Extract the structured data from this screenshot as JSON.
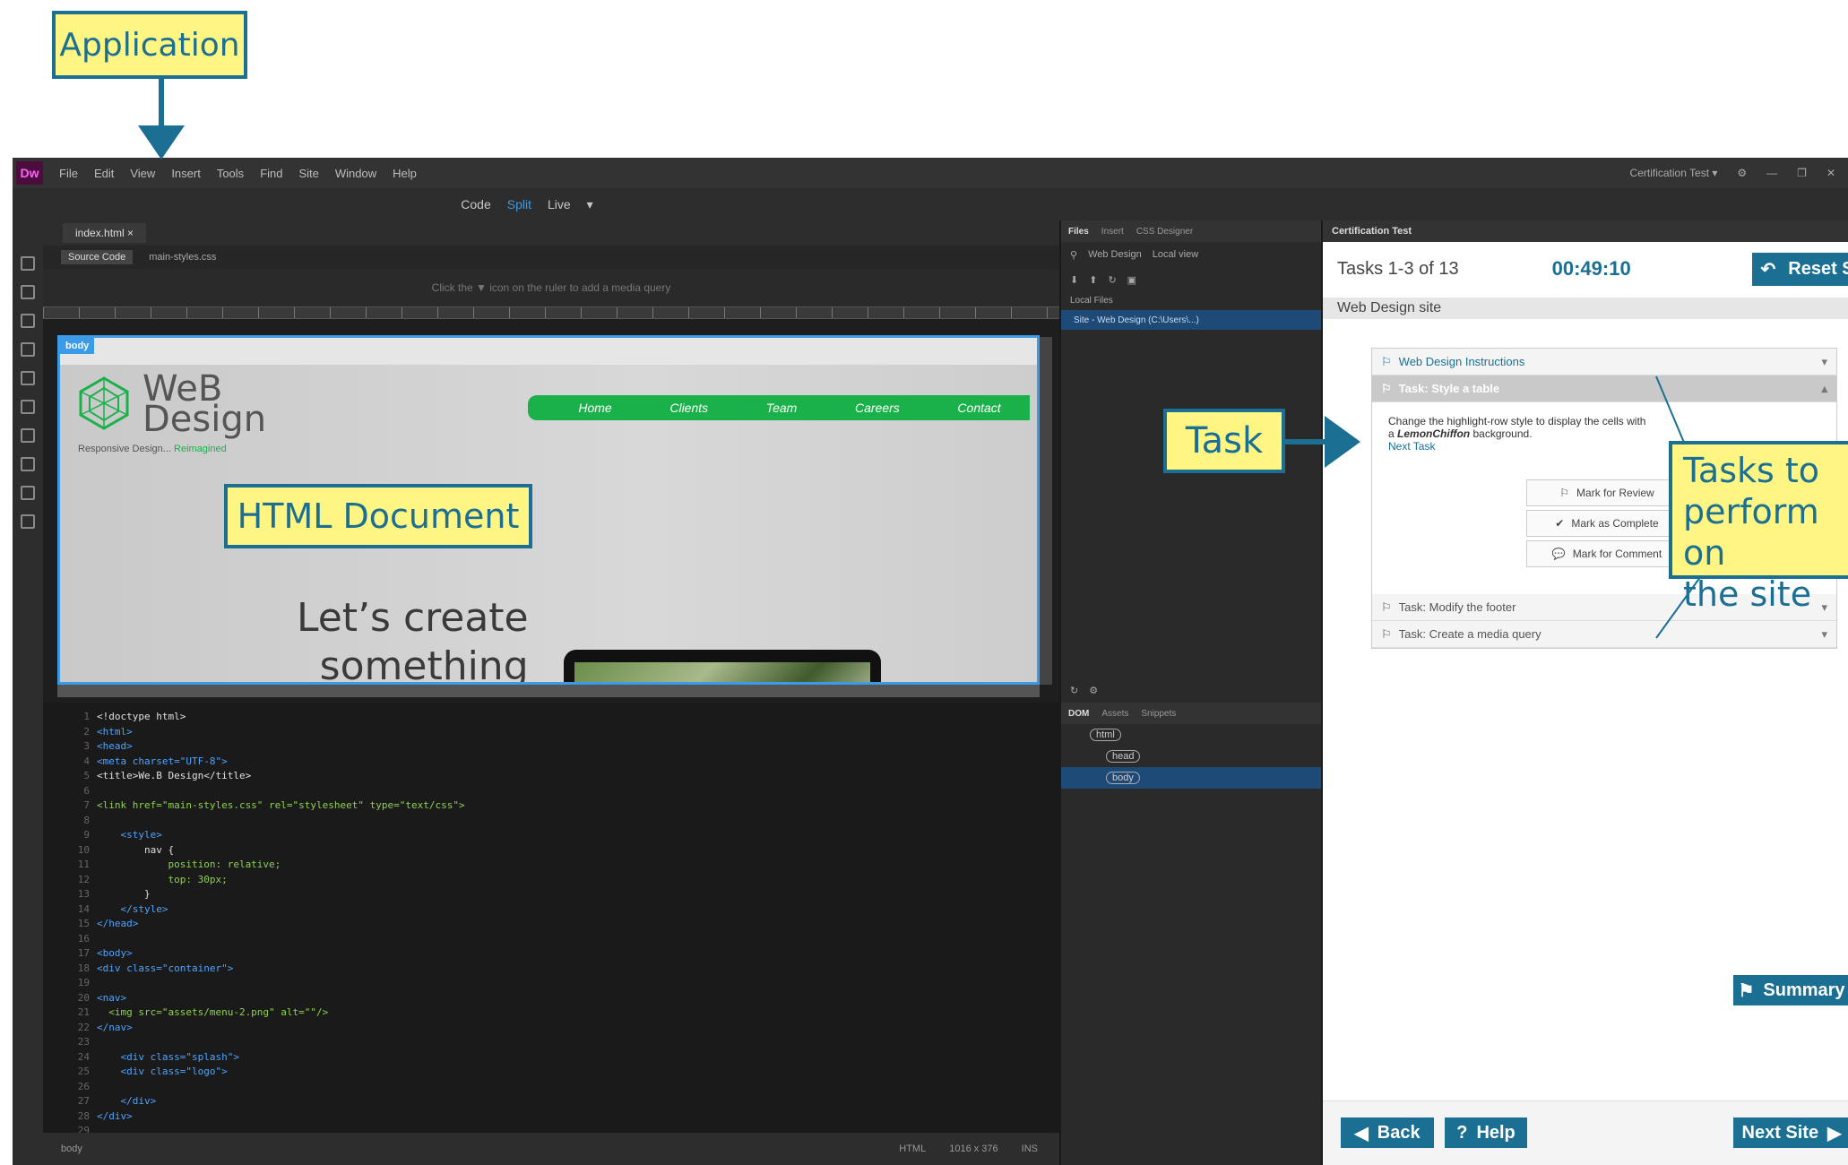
{
  "callouts": {
    "application": "Application",
    "html_document": "HTML Document",
    "task": "Task",
    "tasks_line1": "Tasks to",
    "tasks_line2": "perform on",
    "tasks_line3": "the site"
  },
  "menubar": {
    "logo": "Dw",
    "items": [
      "File",
      "Edit",
      "View",
      "Insert",
      "Tools",
      "Find",
      "Site",
      "Window",
      "Help"
    ],
    "workspace": "Certification Test",
    "workspace_chevron": "▾"
  },
  "viewbar": {
    "code": "Code",
    "split": "Split",
    "live": "Live",
    "chevron": "▾"
  },
  "document": {
    "tab": "index.html",
    "tab_close": "×",
    "related_files": [
      "Source Code",
      "main-styles.css"
    ],
    "media_query_hint": "Click the ▼ icon on the ruler to add a media query",
    "body_tag": "body",
    "site": {
      "logo_line1": "WeB",
      "logo_line2": "Design",
      "tagline": "Responsive Design...",
      "tagline_accent": "Reimagined",
      "nav": [
        "Home",
        "Clients",
        "Team",
        "Careers",
        "Contact"
      ],
      "hero_line1": "Let’s create",
      "hero_line2": "something"
    },
    "code_lines": [
      {
        "n": "1",
        "t": "<!doctype html>",
        "k": "txt"
      },
      {
        "n": "2",
        "t": "<html>",
        "k": "tag"
      },
      {
        "n": "3",
        "t": "<head>",
        "k": "tag"
      },
      {
        "n": "4",
        "t": "<meta charset=\"UTF-8\">",
        "k": "tag"
      },
      {
        "n": "5",
        "t": "<title>We.B Design</title>",
        "k": "txt"
      },
      {
        "n": "6",
        "t": "",
        "k": "txt"
      },
      {
        "n": "7",
        "t": "<link href=\"main-styles.css\" rel=\"stylesheet\" type=\"text/css\">",
        "k": "code"
      },
      {
        "n": "8",
        "t": "",
        "k": "txt"
      },
      {
        "n": "9",
        "t": "    <style>",
        "k": "tag"
      },
      {
        "n": "10",
        "t": "        nav {",
        "k": "txt"
      },
      {
        "n": "11",
        "t": "            position: relative;",
        "k": "code"
      },
      {
        "n": "12",
        "t": "            top: 30px;",
        "k": "code"
      },
      {
        "n": "13",
        "t": "        }",
        "k": "txt"
      },
      {
        "n": "14",
        "t": "    </style>",
        "k": "tag"
      },
      {
        "n": "15",
        "t": "</head>",
        "k": "tag"
      },
      {
        "n": "16",
        "t": "",
        "k": "txt"
      },
      {
        "n": "17",
        "t": "<body>",
        "k": "tag"
      },
      {
        "n": "18",
        "t": "<div class=\"container\">",
        "k": "tag"
      },
      {
        "n": "19",
        "t": "",
        "k": "txt"
      },
      {
        "n": "20",
        "t": "<nav>",
        "k": "tag"
      },
      {
        "n": "21",
        "t": "  <img src=\"assets/menu-2.png\" alt=\"\"/>",
        "k": "code"
      },
      {
        "n": "22",
        "t": "</nav>",
        "k": "tag"
      },
      {
        "n": "23",
        "t": "",
        "k": "txt"
      },
      {
        "n": "24",
        "t": "    <div class=\"splash\">",
        "k": "tag"
      },
      {
        "n": "25",
        "t": "    <div class=\"logo\">",
        "k": "tag"
      },
      {
        "n": "26",
        "t": "",
        "k": "txt"
      },
      {
        "n": "27",
        "t": "    </div>",
        "k": "tag"
      },
      {
        "n": "28",
        "t": "</div>",
        "k": "tag"
      },
      {
        "n": "29",
        "t": "",
        "k": "txt"
      }
    ],
    "status": {
      "tag": "body",
      "mode": "HTML",
      "size": "1016 x 376",
      "ins": "INS"
    }
  },
  "files_panel": {
    "tabs": [
      "Files",
      "Insert",
      "CSS Designer"
    ],
    "site_dropdown": "Web Design",
    "view_dropdown": "Local view",
    "local_files": "Local Files",
    "site_row": "Site - Web Design (C:\\Users\\...)",
    "dom_tabs": [
      "DOM",
      "Assets",
      "Snippets"
    ],
    "dom_nodes": [
      "html",
      "head",
      "body"
    ]
  },
  "cert": {
    "panel_title": "Certification Test",
    "tasks_count": "Tasks 1-3 of 13",
    "timer": "00:49:10",
    "reset": "Reset Site",
    "site_name": "Web Design site",
    "rows": {
      "instructions": "Web Design Instructions",
      "task1": "Task: Style a table",
      "task2": "Task: Modify the footer",
      "task3": "Task: Create a media query"
    },
    "task_text_1": "Change the highlight-row style to display the cells with",
    "task_text_2a": "a",
    "task_text_em": "LemonChiffon",
    "task_text_2b": "background.",
    "next_task": "Next Task",
    "mark_review": "Mark for Review",
    "mark_complete": "Mark as Complete",
    "mark_comment": "Mark for Comment",
    "summary": "Summary",
    "back": "Back",
    "help": "Help",
    "next_site": "Next Site"
  }
}
